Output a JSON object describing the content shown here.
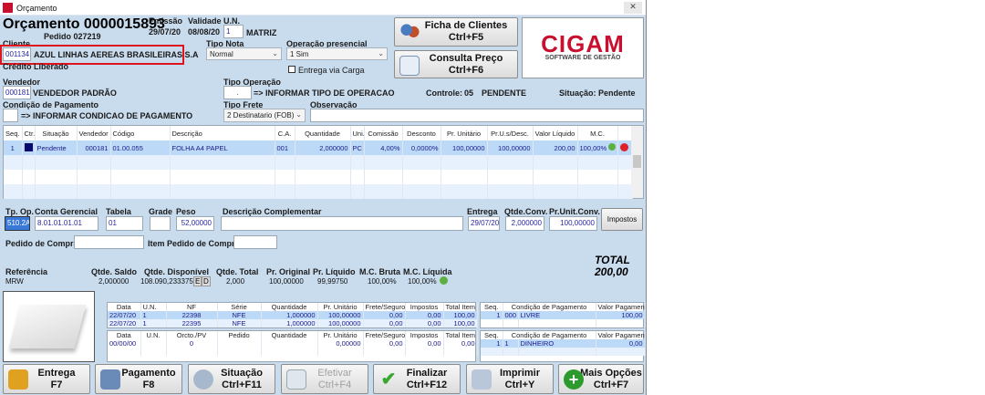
{
  "window": {
    "title": "Orçamento",
    "close": "✕"
  },
  "header": {
    "title": "Orçamento 0000015893",
    "pedido": "Pedido 027219",
    "emissao_label": "Emissão",
    "emissao": "29/07/20",
    "validade_label": "Validade",
    "validade": "08/08/20",
    "un_label": "U.N.",
    "un": "1",
    "un_name": "MATRIZ"
  },
  "cliente": {
    "label": "Cliente",
    "code": "001134",
    "name": "AZUL LINHAS AEREAS BRASILEIRAS S.A",
    "credito": "Crédito Liberado"
  },
  "tipo_nota": {
    "label": "Tipo Nota",
    "value": "Normal"
  },
  "operacao_presencial": {
    "label": "Operação presencial",
    "value": "1 Sim"
  },
  "entrega_carga": {
    "label": "Entrega via Carga",
    "checked": false
  },
  "vendedor": {
    "label": "Vendedor",
    "code": "000181",
    "name": "VENDEDOR PADRÃO"
  },
  "tipo_operacao": {
    "label": "Tipo Operação",
    "value": ".",
    "text": "=> INFORMAR TIPO DE OPERACAO"
  },
  "controle": {
    "label": "Controle:",
    "value": "05",
    "status": "PENDENTE"
  },
  "situacao": {
    "label": "Situação:",
    "value": "Pendente"
  },
  "cond_pagamento": {
    "label": "Condição de Pagamento",
    "value": "",
    "text": "=> INFORMAR CONDICAO DE PAGAMENTO"
  },
  "tipo_frete": {
    "label": "Tipo Frete",
    "value": "2 Destinatario (FOB)"
  },
  "observacao": {
    "label": "Observação",
    "value": ""
  },
  "top_buttons": [
    {
      "label": "Ficha de Clientes",
      "shortcut": "Ctrl+F5"
    },
    {
      "label": "Consulta Preço",
      "shortcut": "Ctrl+F6"
    }
  ],
  "logo": {
    "text": "CIGAM",
    "sub": "SOFTWARE DE GESTÃO",
    "color": "#c8102e"
  },
  "items_grid": {
    "columns": [
      "Seq.",
      "Ctr.",
      "Situação",
      "Vendedor",
      "Código",
      "Descrição",
      "C.A.",
      "Quantidade",
      "Uni.",
      "Comissão",
      "Desconto",
      "Pr. Unitário",
      "Pr.U.s/Desc.",
      "Valor Líquido",
      "M.C."
    ],
    "rows": [
      [
        "1",
        "",
        "Pendente",
        "000181",
        "01.00.055",
        "FOLHA A4 PAPEL",
        "001",
        "2,000000",
        "PC",
        "4,00%",
        "0,0000%",
        "100,00000",
        "100,00000",
        "200,00",
        "100,00%"
      ]
    ]
  },
  "detail": {
    "tp_op": {
      "label": "Tp. Op.",
      "value": "510.2A"
    },
    "conta": {
      "label": "Conta Gerencial",
      "value": "8.01.01.01.01"
    },
    "tabela": {
      "label": "Tabela",
      "value": "01"
    },
    "grade": {
      "label": "Grade",
      "value": ""
    },
    "peso": {
      "label": "Peso",
      "value": "52,00000"
    },
    "desc_comp": {
      "label": "Descrição Complementar",
      "value": ""
    },
    "entrega": {
      "label": "Entrega",
      "value": "29/07/20"
    },
    "qtde_conv": {
      "label": "Qtde.Conv.",
      "value": "2,000000"
    },
    "pr_unit_conv": {
      "label": "Pr.Unit.Conv.",
      "value": "100,00000"
    },
    "impostos": "Impostos",
    "pedido_compra": {
      "label": "Pedido de Compra",
      "value": ""
    },
    "item_pedido": {
      "label": "Item Pedido de Compra",
      "value": ""
    }
  },
  "total": {
    "label": "TOTAL",
    "value": "200,00"
  },
  "summary": [
    {
      "label": "Referência",
      "value": "MRW"
    },
    {
      "label": "Qtde. Saldo",
      "value": "2,000000"
    },
    {
      "label": "Qtde. Disponível",
      "value": "108.090,233375"
    },
    {
      "label": "Qtde. Total",
      "value": "2,000"
    },
    {
      "label": "Pr. Original",
      "value": "100,00000"
    },
    {
      "label": "Pr. Líquido",
      "value": "99,99750"
    },
    {
      "label": "M.C. Bruta",
      "value": "100,00%"
    },
    {
      "label": "M.C. Líquida",
      "value": "100,00%"
    }
  ],
  "ed": [
    "E",
    "D"
  ],
  "nf_grid": {
    "columns": [
      "Data",
      "U.N.",
      "NF",
      "Série",
      "Quantidade",
      "Pr. Unitário",
      "Frete/Seguro",
      "Impostos",
      "Total Item"
    ],
    "rows": [
      [
        "22/07/20",
        "1",
        "22398",
        "NFE",
        "1,000000",
        "100,00000",
        "0,00",
        "0,00",
        "100,00"
      ],
      [
        "22/07/20",
        "1",
        "22395",
        "NFE",
        "1,000000",
        "100,00000",
        "0,00",
        "0,00",
        "100,00"
      ]
    ]
  },
  "pag_grid1": {
    "columns": [
      "Seq.",
      "Condição de Pagamento",
      "Valor Pagamento"
    ],
    "rows": [
      [
        "1",
        "000",
        "LIVRE",
        "100,00"
      ]
    ]
  },
  "orc_grid": {
    "columns": [
      "Data",
      "U.N.",
      "Orcto./PV",
      "Pedido",
      "Quantidade",
      "Pr. Unitário",
      "Frete/Seguro",
      "Impostos",
      "Total Item"
    ],
    "rows": [
      [
        "00/00/00",
        "",
        "0",
        "",
        "",
        "0,00000",
        "0,00",
        "0,00",
        "0,00"
      ]
    ]
  },
  "pag_grid2": {
    "columns": [
      "Seq.",
      "Condição de Pagamento",
      "Valor Pagamento"
    ],
    "rows": [
      [
        "1",
        "1",
        "DINHEIRO",
        "0,00"
      ]
    ]
  },
  "bottom_buttons": [
    {
      "label": "Entrega",
      "shortcut": "F7",
      "icon": "box-icon"
    },
    {
      "label": "Pagamento",
      "shortcut": "F8",
      "icon": "cash-register-icon"
    },
    {
      "label": "Situação",
      "shortcut": "Ctrl+F11",
      "icon": "gear-check-icon"
    },
    {
      "label": "Efetivar",
      "shortcut": "Ctrl+F4",
      "icon": "document-check-icon",
      "disabled": true
    },
    {
      "label": "Finalizar",
      "shortcut": "Ctrl+F12",
      "icon": "checkmark-icon"
    },
    {
      "label": "Imprimir",
      "shortcut": "Ctrl+Y",
      "icon": "printer-icon"
    },
    {
      "label": "Mais Opções",
      "shortcut": "Ctrl+F7",
      "icon": "plus-icon"
    }
  ]
}
